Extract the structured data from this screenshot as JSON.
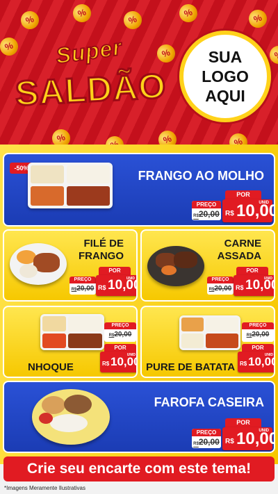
{
  "header": {
    "title_line1": "Super",
    "title_line2": "SALDÃO",
    "logo_lines": [
      "SUA",
      "LOGO",
      "AQUI"
    ],
    "badge_symbol": "%"
  },
  "products": [
    {
      "name": "FRANGO AO MOLHO",
      "discount": "-50%",
      "old_price": "20,00",
      "new_price": "10,00"
    },
    {
      "name_lines": [
        "FILÉ DE",
        "FRANGO"
      ],
      "old_price": "20,00",
      "new_price": "10,00"
    },
    {
      "name_lines": [
        "CARNE",
        "ASSADA"
      ],
      "old_price": "20,00",
      "new_price": "10,00"
    },
    {
      "name": "NHOQUE",
      "old_price": "20,00",
      "new_price": "10,00"
    },
    {
      "name": "PURE DE BATATA",
      "old_price": "20,00",
      "new_price": "10,00"
    },
    {
      "name": "FAROFA CASEIRA",
      "old_price": "20,00",
      "new_price": "10,00"
    }
  ],
  "labels": {
    "preco": "PREÇO",
    "por": "POR",
    "currency": "R$",
    "unid": "UNID"
  },
  "footer": {
    "cta": "Crie seu encarte com este tema!",
    "disclaimer": "*Imagens Meramente Ilustrativas"
  },
  "colors": {
    "red": "#e11b22",
    "blue": "#2a51d6",
    "yellow": "#f7c700"
  }
}
